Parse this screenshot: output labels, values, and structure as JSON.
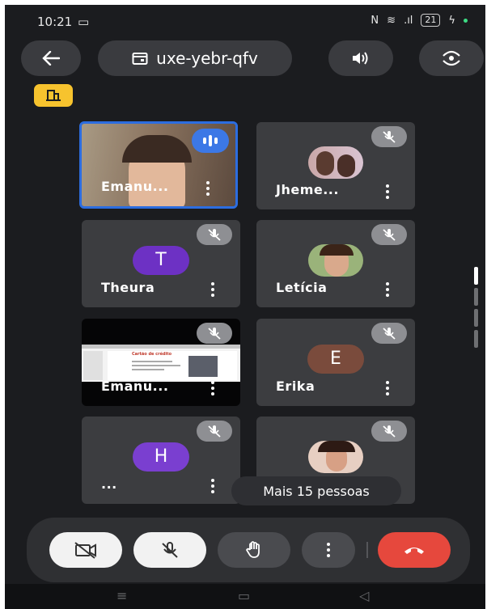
{
  "status_bar": {
    "time": "10:21",
    "battery": "21"
  },
  "header": {
    "meeting_code": "uxe-yebr-qfv"
  },
  "participants": [
    {
      "name": "Emanu...",
      "type": "video",
      "active": true
    },
    {
      "name": "Jheme...",
      "type": "photo"
    },
    {
      "name": "Theura",
      "initial": "T",
      "avatar_color": "#6d31c4"
    },
    {
      "name": "Letícia",
      "type": "photo"
    },
    {
      "name": "Emanu...",
      "type": "screen"
    },
    {
      "name": "Erika",
      "initial": "E",
      "avatar_color": "#7a4b3c"
    },
    {
      "name": "...",
      "initial": "H",
      "avatar_color": "#7a3fd0"
    },
    {
      "name": "",
      "type": "photo"
    }
  ],
  "screen_share": {
    "slide_title": "Cartão de crédito"
  },
  "more_people": "Mais 15 pessoas",
  "colors": {
    "accent": "#2c6de0",
    "end_call": "#e6483d",
    "badge": "#f7c32e"
  }
}
